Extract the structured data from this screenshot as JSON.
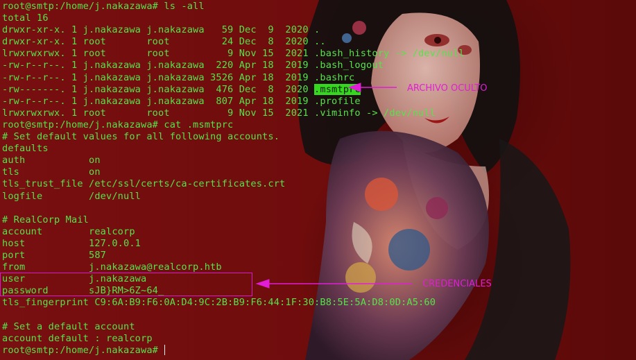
{
  "terminal": {
    "lines": [
      "root@smtp:/home/j.nakazawa# ls -all",
      "total 16",
      "drwxr-xr-x. 1 j.nakazawa j.nakazawa   59 Dec  9  2020 .",
      "drwxr-xr-x. 1 root       root         24 Dec  8  2020 ..",
      "lrwxrwxrwx. 1 root       root          9 Nov 15  2021 .bash_history -> /dev/null",
      "-rw-r--r--. 1 j.nakazawa j.nakazawa  220 Apr 18  2019 .bash_logout",
      "-rw-r--r--. 1 j.nakazawa j.nakazawa 3526 Apr 18  2019 .bashrc",
      "-rw-------. 1 j.nakazawa j.nakazawa  476 Dec  8  2020 ",
      "-rw-r--r--. 1 j.nakazawa j.nakazawa  807 Apr 18  2019 .profile",
      "lrwxrwxrwx. 1 root       root          9 Nov 15  2021 .viminfo -> /dev/null",
      "root@smtp:/home/j.nakazawa# cat .msmtprc",
      "# Set default values for all following accounts.",
      "defaults",
      "auth           on",
      "tls            on",
      "tls_trust_file /etc/ssl/certs/ca-certificates.crt",
      "logfile        /dev/null",
      "",
      "# RealCorp Mail",
      "account        realcorp",
      "host           127.0.0.1",
      "port           587",
      "from           j.nakazawa@realcorp.htb",
      "user           j.nakazawa",
      "password       sJB}RM>6Z~64_",
      "tls_fingerprint C9:6A:B9:F6:0A:D4:9C:2B:B9:F6:44:1F:30:B8:5E:5A:D8:0D:A5:60",
      "",
      "# Set a default account",
      "account default : realcorp",
      "root@smtp:/home/j.nakazawa# "
    ],
    "highlighted_file": ".msmtprc"
  },
  "annotations": {
    "hidden_file_label": "ARCHIVO OCULTO",
    "credentials_label": "CREDENCIALES"
  },
  "colors": {
    "terminal_text": "#57e34b",
    "highlight_bg": "#36d81f",
    "annotation": "#e11dd6",
    "background": "#6b0d0d"
  }
}
